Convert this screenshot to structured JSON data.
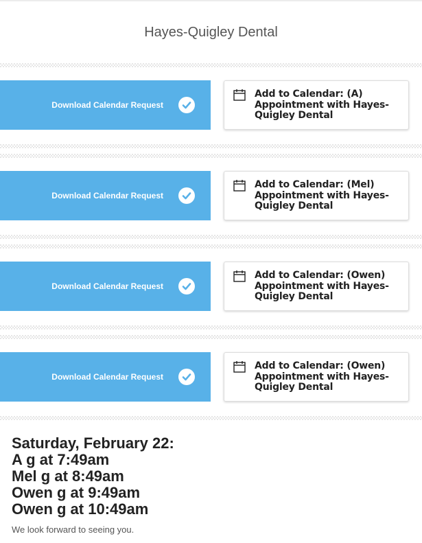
{
  "header": {
    "title": "Hayes-Quigley Dental"
  },
  "rows": [
    {
      "download_label": "Download Calendar Request",
      "calendar_label": "Add to Calendar: (A) Appointment with Hayes-Quigley Dental"
    },
    {
      "download_label": "Download Calendar Request",
      "calendar_label": "Add to Calendar: (Mel) Appointment with Hayes-Quigley Dental"
    },
    {
      "download_label": "Download Calendar Request",
      "calendar_label": "Add to Calendar: (Owen) Appointment with Hayes-Quigley Dental"
    },
    {
      "download_label": "Download Calendar Request",
      "calendar_label": "Add to Calendar: (Owen) Appointment with Hayes-Quigley Dental"
    }
  ],
  "summary": {
    "date": "Saturday, February 22:",
    "appointments": [
      "A g at 7:49am",
      "Mel g at 8:49am",
      "Owen g at 9:49am",
      "Owen g at 10:49am"
    ]
  },
  "footer": {
    "note": "We look forward to seeing you."
  },
  "colors": {
    "button_blue": "#58b1e8",
    "text_dark": "#222222",
    "text_muted": "#555555"
  },
  "icons": {
    "download_check": "check-circle-icon",
    "calendar": "calendar-icon"
  }
}
